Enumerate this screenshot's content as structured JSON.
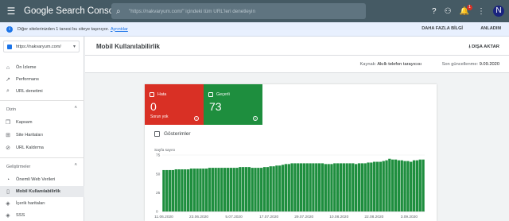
{
  "topbar": {
    "brand": "Google Search Console",
    "search_placeholder": "\"https://nakvaryum.com/\" içindeki tüm URL'leri denetleyin",
    "bell_count": "1",
    "avatar_letter": "N"
  },
  "notice": {
    "message": "Diğer sitelerinizden 1 tanesi bu siteye taşınıyor.",
    "link": "Ayrıntılar",
    "more": "DAHA FAZLA BİLGİ",
    "ok": "ANLADIM"
  },
  "sidebar": {
    "property": "https://nakvaryum.com/",
    "items_top": [
      {
        "label": "Ön İzleme",
        "icon": "home-icon"
      },
      {
        "label": "Performans",
        "icon": "trend-icon"
      },
      {
        "label": "URL denetimi",
        "icon": "search-icon"
      }
    ],
    "section_index": "Dizin",
    "items_index": [
      {
        "label": "Kapsam",
        "icon": "copy-icon"
      },
      {
        "label": "Site Haritaları",
        "icon": "sitemap-icon"
      },
      {
        "label": "URL Kaldırma",
        "icon": "remove-icon"
      }
    ],
    "section_enh": "Geliştirmeler",
    "items_enh": [
      {
        "label": "Önemli Web Verileri",
        "icon": "gauge-icon"
      },
      {
        "label": "Mobil Kullanılabilirlik",
        "icon": "phone-icon",
        "active": true
      },
      {
        "label": "İçerik haritaları",
        "icon": "layers-icon"
      },
      {
        "label": "SSS",
        "icon": "faq-icon"
      }
    ]
  },
  "main": {
    "title": "Mobil Kullanılabilirlik",
    "export": "DIŞA AKTAR",
    "source_label": "Kaynak:",
    "source_value": "Akıllı telefon tarayıcısı",
    "updated_label": "Son güncellenme:",
    "updated_value": "9.09.2020"
  },
  "tiles": {
    "error": {
      "label": "Hata",
      "value": "0",
      "sub": "Sorun yok",
      "color": "#d93025"
    },
    "valid": {
      "label": "Geçerli",
      "value": "73",
      "color": "#1e8e3e"
    }
  },
  "impressions_label": "Gösterimler",
  "chart_data": {
    "type": "bar",
    "ylabel": "Sayfa sayısı",
    "ylim": [
      0,
      75
    ],
    "yticks": [
      0,
      25,
      50,
      75
    ],
    "xticks": [
      "11.06.2020",
      "23.06.2020",
      "5.07.2020",
      "17.07.2020",
      "29.07.2020",
      "10.08.2020",
      "22.08.2020",
      "3.09.2020"
    ],
    "series": [
      {
        "color": "#1e8e3e",
        "values": [
          55,
          55,
          55,
          55,
          56,
          56,
          56,
          56,
          56,
          57,
          57,
          57,
          57,
          57,
          57,
          58,
          58,
          58,
          58,
          58,
          58,
          58,
          58,
          58,
          58,
          59,
          59,
          59,
          59,
          58,
          58,
          58,
          58,
          59,
          59,
          60,
          60,
          61,
          61,
          62,
          63,
          63,
          64,
          64,
          64,
          64,
          64,
          64,
          64,
          64,
          64,
          64,
          64,
          63,
          63,
          63,
          64,
          64,
          64,
          64,
          64,
          64,
          64,
          63,
          64,
          64,
          64,
          65,
          65,
          66,
          66,
          66,
          67,
          68,
          70,
          69,
          69,
          68,
          68,
          67,
          67,
          66,
          68,
          68,
          69,
          69
        ]
      }
    ]
  }
}
